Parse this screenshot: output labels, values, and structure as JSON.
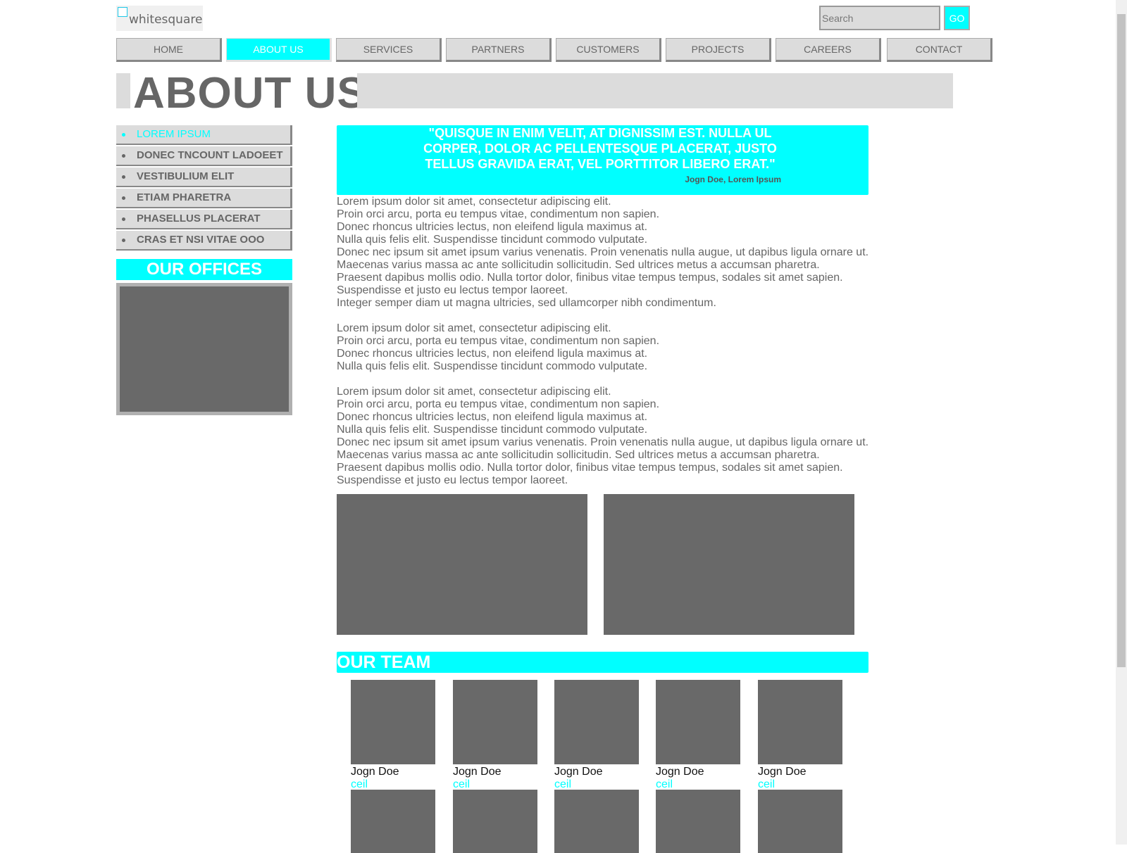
{
  "header": {
    "logo_text": "whitesquare",
    "search_placeholder": "Search",
    "go_label": "GO"
  },
  "nav": {
    "items": [
      "HOME",
      "ABOUT US",
      "SERVICES",
      "PARTNERS",
      "CUSTOMERS",
      "PROJECTS",
      "CAREERS",
      "CONTACT"
    ],
    "active": "ABOUT US"
  },
  "page_title": "ABOUT US",
  "sidebar": {
    "items": [
      {
        "label": "LOREM IPSUM",
        "active": true
      },
      {
        "label": "DONEC TNCOUNT LADOEET"
      },
      {
        "label": "VESTIBULIUM ELIT"
      },
      {
        "label": "ETIAM PHARETRA"
      },
      {
        "label": "PHASELLUS PLACERAT"
      },
      {
        "label": "CRAS ET NSI VITAE OOO"
      }
    ],
    "offices_heading": "OUR OFFICES"
  },
  "quote": {
    "text": "\"QUISQUE IN ENIM VELIT, AT DIGNISSIM EST. NULLA UL CORPER, DOLOR AC PELLENTESQUE PLACERAT, JUSTO TELLUS GRAVIDA ERAT, VEL PORTTITOR LIBERO ERAT.\"",
    "author": "Jogn Doe, Lorem Ipsum"
  },
  "body": {
    "paragraphs": [
      [
        "Lorem ipsum dolor sit amet, consectetur adipiscing elit.",
        "Proin orci arcu, porta eu tempus vitae, condimentum non sapien.",
        "Donec rhoncus ultricies lectus, non eleifend ligula maximus at.",
        "Nulla quis felis elit. Suspendisse tincidunt commodo vulputate.",
        "Donec nec ipsum sit amet ipsum varius venenatis. Proin venenatis nulla augue, ut dapibus ligula ornare ut.",
        "Maecenas varius massa ac ante sollicitudin sollicitudin. Sed ultrices metus a accumsan pharetra.",
        "Praesent dapibus mollis odio. Nulla tortor dolor, finibus vitae tempus tempus, sodales sit amet sapien.",
        "Suspendisse et justo eu lectus tempor laoreet.",
        "Integer semper diam ut magna ultricies, sed ullamcorper nibh condimentum."
      ],
      [
        "Lorem ipsum dolor sit amet, consectetur adipiscing elit.",
        "Proin orci arcu, porta eu tempus vitae, condimentum non sapien.",
        "Donec rhoncus ultricies lectus, non eleifend ligula maximus at.",
        "Nulla quis felis elit. Suspendisse tincidunt commodo vulputate."
      ],
      [
        "Lorem ipsum dolor sit amet, consectetur adipiscing elit.",
        "Proin orci arcu, porta eu tempus vitae, condimentum non sapien.",
        "Donec rhoncus ultricies lectus, non eleifend ligula maximus at.",
        "Nulla quis felis elit. Suspendisse tincidunt commodo vulputate.",
        "Donec nec ipsum sit amet ipsum varius venenatis. Proin venenatis nulla augue, ut dapibus ligula ornare ut.",
        "Maecenas varius massa ac ante sollicitudin sollicitudin. Sed ultrices metus a accumsan pharetra.",
        "Praesent dapibus mollis odio. Nulla tortor dolor, finibus vitae tempus tempus, sodales sit amet sapien.",
        "Suspendisse et justo eu lectus tempor laoreet."
      ]
    ]
  },
  "team": {
    "heading": "OUR TEAM",
    "members": [
      {
        "name": "Jogn Doe",
        "role": "ceil"
      },
      {
        "name": "Jogn Doe",
        "role": "ceil"
      },
      {
        "name": "Jogn Doe",
        "role": "ceil"
      },
      {
        "name": "Jogn Doe",
        "role": "ceil"
      },
      {
        "name": "Jogn Doe",
        "role": "ceil"
      }
    ]
  },
  "colors": {
    "accent": "#00ffff",
    "panel": "#dcdcdc",
    "placeholder_image": "#696969",
    "text": "#666666"
  }
}
